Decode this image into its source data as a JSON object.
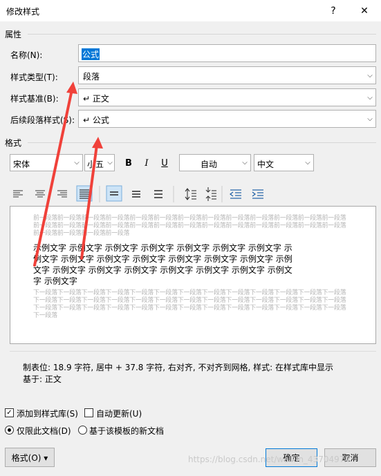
{
  "window": {
    "title": "修改样式",
    "help_icon": "?",
    "close_icon": "✕"
  },
  "sections": {
    "properties": "属性",
    "format": "格式"
  },
  "properties": {
    "name_label": "名称(N):",
    "name_value": "公式",
    "style_type_label": "样式类型(T):",
    "style_type_value": "段落",
    "style_based_label": "样式基准(B):",
    "style_based_value": "↵ 正文",
    "next_style_label": "后续段落样式(S):",
    "next_style_value": "↵ 公式"
  },
  "format": {
    "font": "宋体",
    "size": "小五",
    "bold": "B",
    "italic": "I",
    "underline": "U",
    "color": "自动",
    "language": "中文"
  },
  "preview": {
    "ghost_before": [
      "前一段落前一段落前一段落前一段落前一段落前一段落前一段落前一段落前一段落前一段落前一段落前一段落前一段落",
      "前一段落前一段落前一段落前一段落前一段落前一段落前一段落前一段落前一段落前一段落前一段落前一段落前一段落",
      "前一段落前一段落前一段落前一段落"
    ],
    "sample_lines": [
      "示例文字  示例文字  示例文字  示例文字  示例文字  示例文字  示例文字  示",
      "例文字  示例文字  示例文字  示例文字  示例文字  示例文字  示例文字  示例",
      "文字  示例文字  示例文字  示例文字  示例文字  示例文字  示例文字  示例文",
      "字  示例文字"
    ],
    "ghost_after": [
      "下一段落下一段落下一段落下一段落下一段落下一段落下一段落下一段落下一段落下一段落下一段落下一段落下一段落",
      "下一段落下一段落下一段落下一段落下一段落下一段落下一段落下一段落下一段落下一段落下一段落下一段落下一段落",
      "下一段落下一段落下一段落下一段落下一段落下一段落下一段落下一段落下一段落下一段落下一段落下一段落下一段落",
      "下一段落"
    ]
  },
  "description": {
    "line1": "制表位:  18.9 字符, 居中 +   37.8 字符, 右对齐, 不对齐到网格, 样式: 在样式库中显示",
    "line2": "基于: 正文"
  },
  "options": {
    "add_to_gallery": "添加到样式库(S)",
    "add_to_gallery_checked": true,
    "auto_update": "自动更新(U)",
    "auto_update_checked": false,
    "only_this_doc": "仅限此文档(D)",
    "new_docs_template": "基于该模板的新文档"
  },
  "buttons": {
    "format": "格式(O) ▾",
    "ok": "确定",
    "cancel": "取消"
  },
  "watermark": "https://blog.csdn.net/weixin_43704974"
}
